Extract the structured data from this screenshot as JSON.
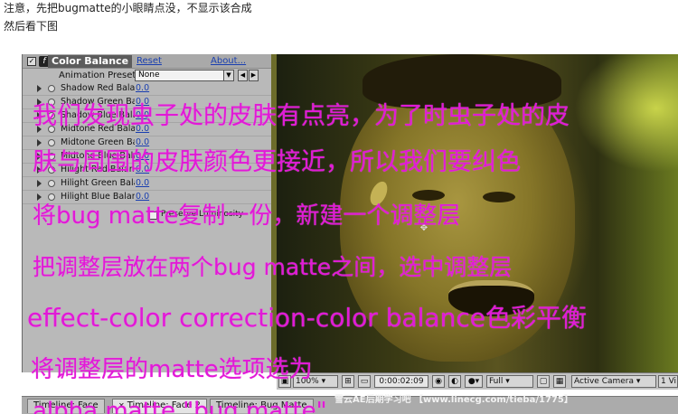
{
  "intro": {
    "line1": "注意，先把bugmatte的小眼睛点没，不显示该合成",
    "line2": "然后看下图"
  },
  "effect_panel": {
    "effect_name": "Color Balance",
    "reset_label": "Reset",
    "about_label": "About...",
    "presets_label": "Animation Presets:",
    "presets_value": "None",
    "properties": [
      {
        "label": "Shadow Red Bala",
        "value": "0.0"
      },
      {
        "label": "Shadow Green Bala",
        "value": "0.0"
      },
      {
        "label": "Shadow Blue Bala",
        "value": "0.0"
      },
      {
        "label": "Midtone Red Bala",
        "value": "0.0"
      },
      {
        "label": "Midtone Green Ba",
        "value": "0.0"
      },
      {
        "label": "Midtone Blue Bala",
        "value": "0.0"
      },
      {
        "label": "Hilight Red Balan",
        "value": "0.0"
      },
      {
        "label": "Hilight Green Bala",
        "value": "0.0"
      },
      {
        "label": "Hilight Blue Balan",
        "value": "0.0"
      }
    ],
    "preserve_label": "Preserve Luminosity"
  },
  "viewer_toolbar": {
    "zoom": "100%",
    "timecode": "0:00:02:09",
    "quality": "Full",
    "camera": "Active Camera",
    "view": "1 Vi"
  },
  "timeline_tabs": [
    {
      "label": "Timeline: Face"
    },
    {
      "label": "Timeline: Face 2"
    },
    {
      "label": "Timeline: Bug Matte"
    }
  ],
  "watermark": "雪云AE后期学习吧 【www.linecg.com/tieba/1775】",
  "annotations": [
    "我们发现虫子处的皮肤有点亮，为了时虫子处的皮",
    "肤与周围的皮肤颜色更接近，所以我们要纠色",
    "将bug matte复制一份，新建一个调整层",
    "把调整层放在两个bug matte之间，选中调整层",
    "effect-color correction-color balance色彩平衡",
    "将调整层的matte选项选为",
    "alpha matte \"bug matte\""
  ],
  "colors": {
    "annotation": "#e01ad6",
    "link": "#1a3fb0",
    "panel_bg": "#b9b9b9"
  }
}
